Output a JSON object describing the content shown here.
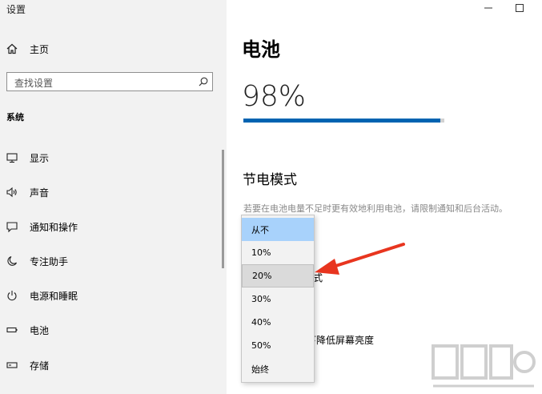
{
  "window": {
    "title": "设置"
  },
  "sidebar": {
    "home_label": "主页",
    "search_placeholder": "查找设置",
    "section_label": "系统",
    "items": [
      {
        "label": "显示",
        "icon": "monitor-icon"
      },
      {
        "label": "声音",
        "icon": "speaker-icon"
      },
      {
        "label": "通知和操作",
        "icon": "notification-icon"
      },
      {
        "label": "专注助手",
        "icon": "moon-icon"
      },
      {
        "label": "电源和睡眠",
        "icon": "power-icon"
      },
      {
        "label": "电池",
        "icon": "battery-icon"
      },
      {
        "label": "存储",
        "icon": "storage-icon"
      }
    ]
  },
  "main": {
    "title": "电池",
    "percent": "98%",
    "level": 0.98,
    "saver_title": "节电模式",
    "saver_desc": "若要在电池电量不足时更有效地利用电池，请限制通知和后台活动。",
    "partial_text_1": "式",
    "partial_text_2": "下降低屏幕亮度"
  },
  "dropdown": {
    "options": [
      "从不",
      "10%",
      "20%",
      "30%",
      "40%",
      "50%",
      "始终"
    ],
    "selected": "从不",
    "hovered": "20%"
  },
  "colors": {
    "accent": "#0063b1",
    "selected_bg": "#a8d2fb",
    "arrow": "#e8351f"
  }
}
